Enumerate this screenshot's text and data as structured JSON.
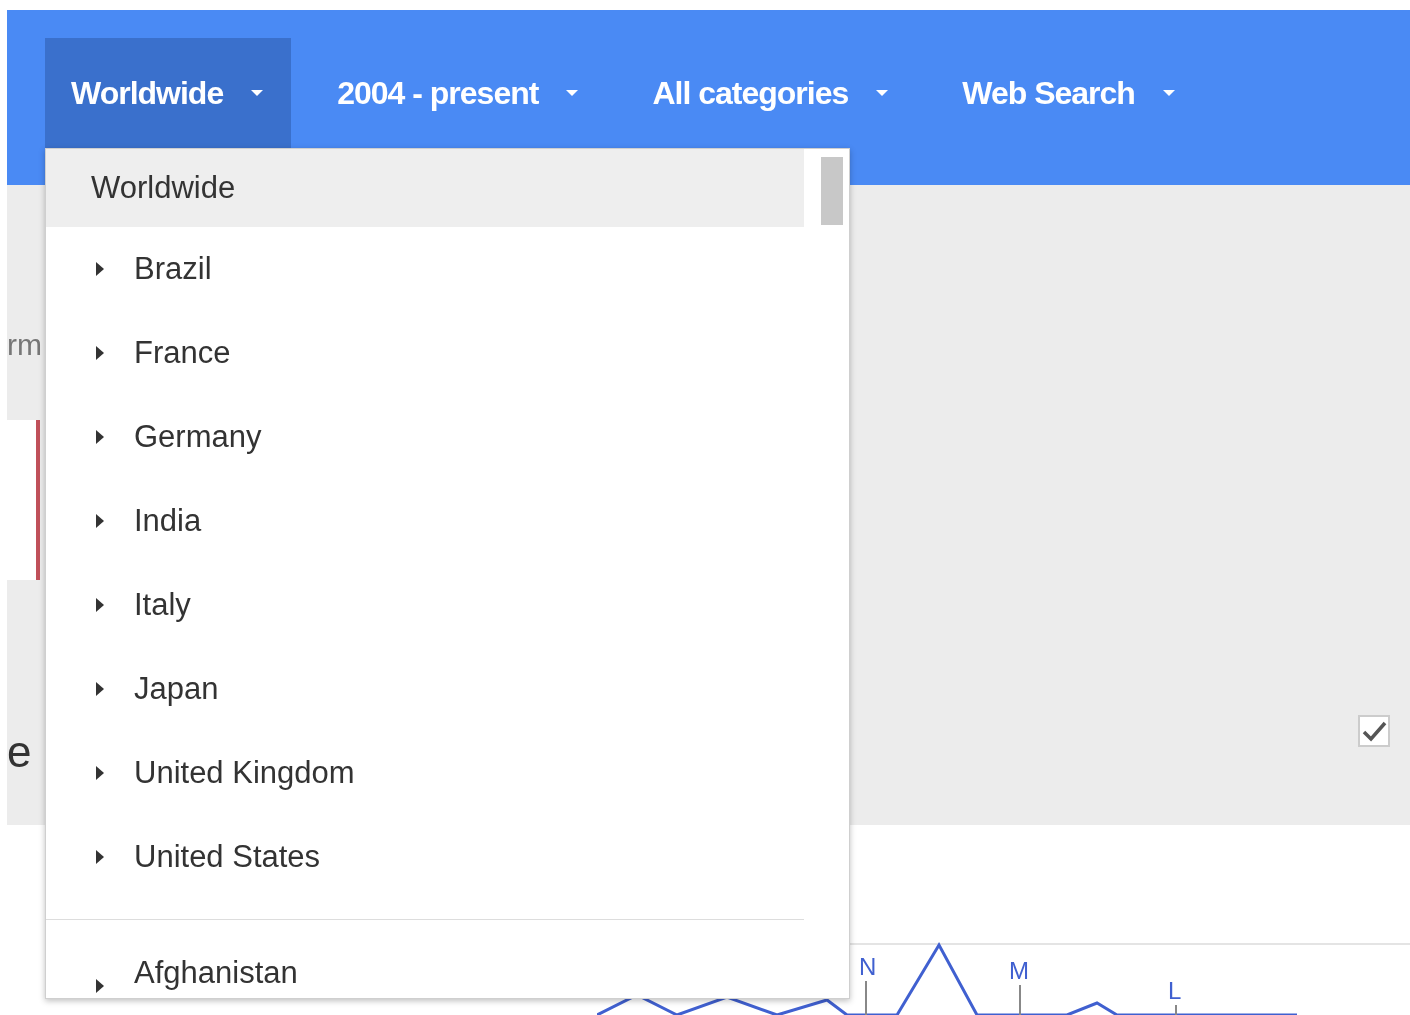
{
  "filters": [
    {
      "label": "Worldwide",
      "selected": true
    },
    {
      "label": "2004 - present",
      "selected": false
    },
    {
      "label": "All categories",
      "selected": false
    },
    {
      "label": "Web Search",
      "selected": false
    }
  ],
  "side_fragments": [
    "rm",
    "e"
  ],
  "compare_checkbox": {
    "checked": true
  },
  "trend_markers": [
    {
      "label": "N"
    },
    {
      "label": "M"
    },
    {
      "label": "L"
    }
  ],
  "region_menu": {
    "items": [
      {
        "label": "Worldwide",
        "kind": "leaf",
        "selected": true
      },
      {
        "label": "Brazil",
        "kind": "group",
        "selected": false
      },
      {
        "label": "France",
        "kind": "group",
        "selected": false
      },
      {
        "label": "Germany",
        "kind": "group",
        "selected": false
      },
      {
        "label": "India",
        "kind": "group",
        "selected": false
      },
      {
        "label": "Italy",
        "kind": "group",
        "selected": false
      },
      {
        "label": "Japan",
        "kind": "group",
        "selected": false
      },
      {
        "label": "United Kingdom",
        "kind": "group",
        "selected": false
      },
      {
        "label": "United States",
        "kind": "group",
        "selected": false
      }
    ],
    "more_items": [
      {
        "label": "Afghanistan",
        "kind": "group",
        "selected": false
      }
    ]
  }
}
